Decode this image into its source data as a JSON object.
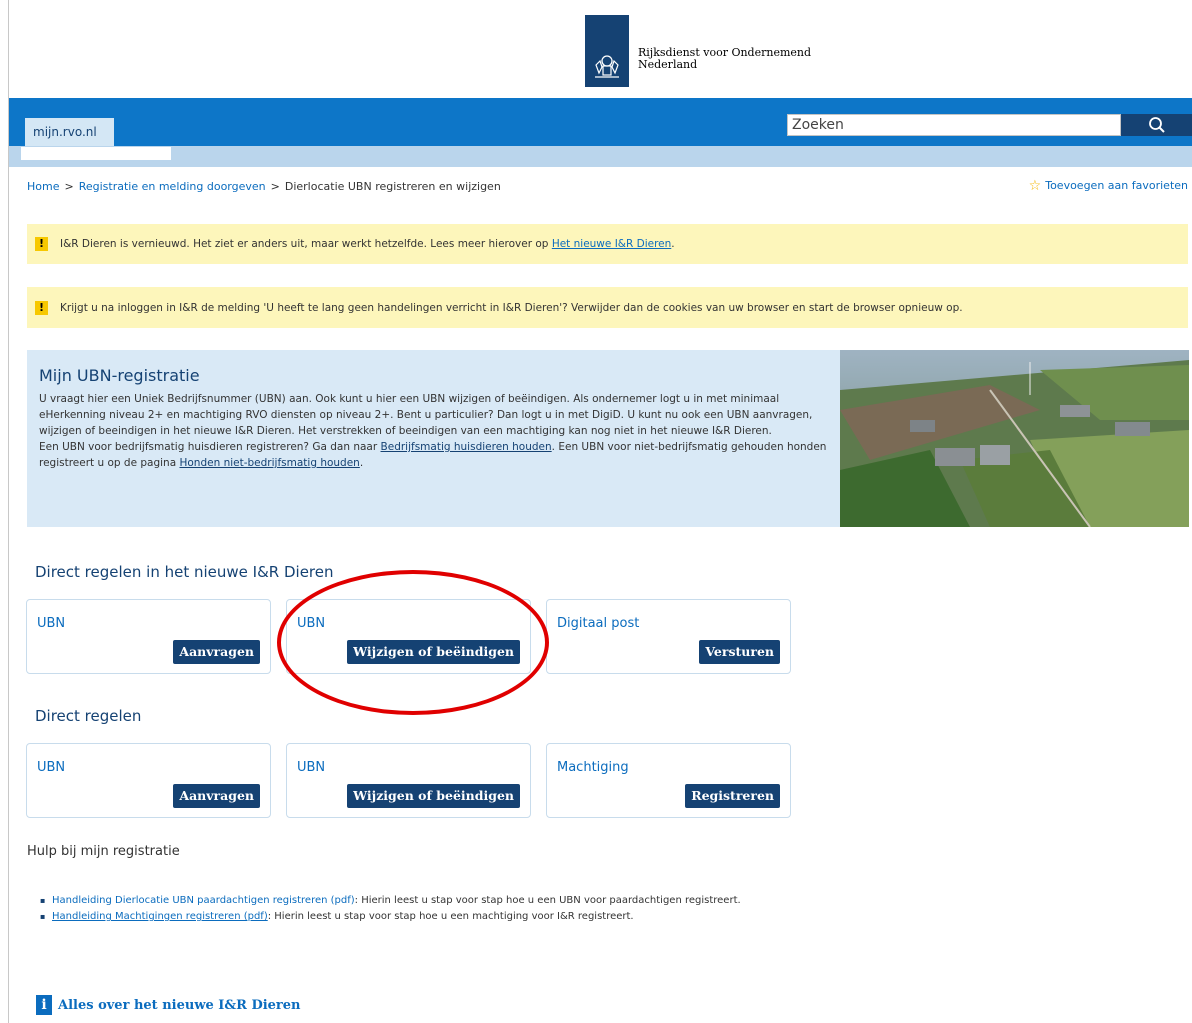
{
  "header": {
    "org_line1": "Rijksdienst voor Ondernemend",
    "org_line2": "Nederland",
    "site_tab": "mijn.rvo.nl",
    "search_placeholder": "Zoeken"
  },
  "breadcrumb": {
    "home": "Home",
    "level1": "Registratie en melding doorgeven",
    "current": "Dierlocatie UBN registreren en wijzigen",
    "separator": ">"
  },
  "favorite_label": "Toevoegen aan favorieten",
  "notices": [
    {
      "text": "I&R Dieren is vernieuwd. Het ziet er anders uit, maar werkt hetzelfde. Lees meer hierover op ",
      "link": "Het nieuwe I&R Dieren",
      "suffix": "."
    },
    {
      "text": "Krijgt u na inloggen in I&R de melding 'U heeft te lang geen handelingen verricht in I&R Dieren'? Verwijder dan de cookies van uw browser en start de browser opnieuw op."
    }
  ],
  "intro": {
    "title": "Mijn UBN-registratie",
    "p1": "U vraagt hier een Uniek Bedrijfsnummer (UBN) aan. Ook kunt u hier een UBN wijzigen of beëindigen. Als ondernemer logt u in met minimaal eHerkenning niveau 2+ en machtiging RVO diensten op niveau 2+. Bent u particulier? Dan logt u in met DigiD. U kunt nu ook een UBN aanvragen, wijzigen of beeindigen in het nieuwe I&R Dieren. Het verstrekken of beeindigen van een machtiging kan nog niet in het nieuwe I&R Dieren.",
    "p2_a": "Een UBN voor bedrijfsmatig huisdieren registreren? Ga dan naar ",
    "p2_link1": "Bedrijfsmatig huisdieren houden",
    "p2_b": ". Een UBN voor niet-bedrijfsmatig gehouden honden registreert u op de pagina ",
    "p2_link2": "Honden niet-bedrijfsmatig houden",
    "p2_c": "."
  },
  "section_new": {
    "title": "Direct regelen in het nieuwe I&R Dieren",
    "cards": [
      {
        "title": "UBN",
        "button": "Aanvragen"
      },
      {
        "title": "UBN",
        "button": "Wijzigen of beëindigen"
      },
      {
        "title": "Digitaal post",
        "button": "Versturen"
      }
    ]
  },
  "section_direct": {
    "title": "Direct regelen",
    "cards": [
      {
        "title": "UBN",
        "button": "Aanvragen"
      },
      {
        "title": "UBN",
        "button": "Wijzigen of beëindigen"
      },
      {
        "title": "Machtiging",
        "button": "Registreren"
      }
    ]
  },
  "help": {
    "title": "Hulp bij mijn registratie",
    "items": [
      {
        "link": "Handleiding Dierlocatie UBN paardachtigen registreren (pdf)",
        "text": ": Hierin leest u stap voor stap hoe u een UBN voor paardachtigen registreert."
      },
      {
        "link": "Handleiding Machtigingen registreren (pdf)",
        "text": ": Hierin leest u stap voor stap hoe u een machtiging voor I&R registreert."
      }
    ]
  },
  "all_about": {
    "icon": "i",
    "label": "Alles over het nieuwe I&R Dieren"
  },
  "colors": {
    "brand_dark": "#154273",
    "brand_blue": "#0d76c8",
    "notice_bg": "#fdf6bb",
    "intro_bg": "#d9e9f6",
    "highlight_circle": "#e00000"
  }
}
